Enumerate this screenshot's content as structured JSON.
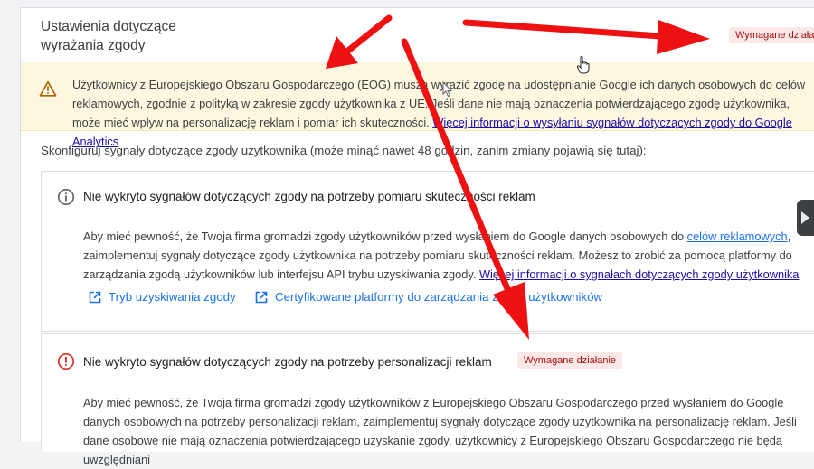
{
  "section": {
    "title_line1": "Ustawienia dotyczące",
    "title_line2": "wyrażania zgody",
    "badge": "Wymagane działar"
  },
  "warning": {
    "text": "Użytkownicy z Europejskiego Obszaru Gospodarczego (EOG) muszą wyrazić zgodę na udostępnianie Google ich danych osobowych do celów reklamowych, zgodnie z polityką w zakresie zgody użytkownika z UE. Jeśli dane nie mają oznaczenia potwierdzającego zgodę użytkownika, może mieć wpływ na personalizację reklam i pomiar ich skuteczności.",
    "link": "Więcej informacji o wysyłaniu sygnałów dotyczących zgody do Google Analytics"
  },
  "configure_text": "Skonfiguruj sygnały dotyczące zgody użytkownika (może minąć nawet 48 godzin, zanim zmiany pojawią się tutaj):",
  "card1": {
    "title": "Nie wykryto sygnałów dotyczących zgody na potrzeby pomiaru skuteczności reklam",
    "body_before": "Aby mieć pewność, że Twoja firma gromadzi zgody użytkowników przed wysłaniem do Google danych osobowych do",
    "body_link1": "celów reklamowych",
    "body_middle": ", zaimplementuj sygnały dotyczące zgody użytkownika na potrzeby pomiaru skuteczności reklam. Możesz to zrobić za pomocą platformy do zarządzania zgodą użytkowników lub interfejsu API trybu uzyskiwania zgody.",
    "body_link2": "Więcej informacji o sygnałach dotyczących zgody użytkownika",
    "action1": "Tryb uzyskiwania zgody",
    "action2": "Certyfikowane platformy do zarządzania zgodą użytkowników"
  },
  "card2": {
    "title": "Nie wykryto sygnałów dotyczących zgody na potrzeby personalizacji reklam",
    "badge": "Wymagane działanie",
    "body": "Aby mieć pewność, że Twoja firma gromadzi zgody użytkowników z Europejskiego Obszaru Gospodarczego przed wysłaniem do Google danych osobowych na potrzeby personalizacji reklam, zaimplementuj sygnały dotyczące zgody użytkownika na personalizację reklam. Jeśli dane osobowe nie mają oznaczenia potwierdzającego uzyskanie zgody, użytkownicy z Europejskiego Obszaru Gospodarczego nie będą uwzględniani"
  },
  "colors": {
    "annotation_arrow": "#ee1111",
    "warning_bg": "#fef7e0",
    "badge_bg": "#fce8e6",
    "link": "#1a73e8"
  },
  "icons": {
    "warning": "warning-triangle-icon",
    "info": "info-circle-icon",
    "error": "error-circle-icon",
    "external_link": "open-in-new-icon",
    "side_toggle": "play-arrow-icon"
  }
}
